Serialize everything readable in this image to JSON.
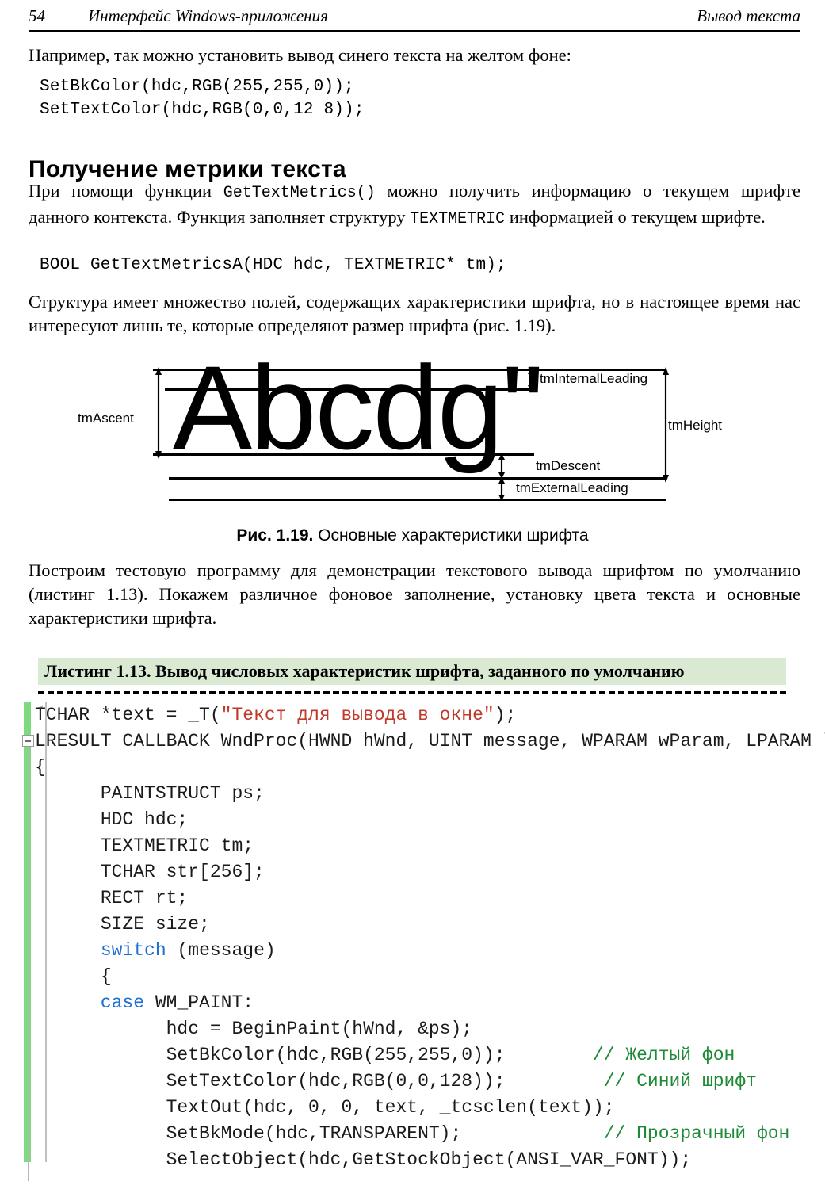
{
  "header": {
    "folio": "54",
    "left_title": "Интерфейс Windows-приложения",
    "right_title": "Вывод текста"
  },
  "intro": {
    "paragraph": "Например, так можно установить вывод синего текста на желтом фоне:",
    "code": [
      "SetBkColor(hdc,RGB(255,255,0));",
      "SetTextColor(hdc,RGB(0,0,12 8));"
    ]
  },
  "section": {
    "heading": "Получение метрики текста",
    "p1_a": "При помощи функции ",
    "p1_mono1": "GetTextMetrics()",
    "p1_b": " можно получить информацию о текущем шрифте данного контекста. Функция заполняет структуру ",
    "p1_mono2": "TEXTMETRIC",
    "p1_c": " информацией о текущем шрифте.",
    "signature": "BOOL GetTextMetricsA(HDC hdc, TEXTMETRIC* tm);",
    "p2": "Структура имеет множество полей, содержащих характеристики шрифта, но в настоящее время нас интересуют лишь те, которые определяют размер шрифта (рис. 1.19)."
  },
  "figure": {
    "sample_text": "Abcdg\"",
    "labels": {
      "ascent": "tmAscent",
      "internal_leading": "tmInternalLeading",
      "height": "tmHeight",
      "descent": "tmDescent",
      "external_leading": "tmExternalLeading"
    },
    "caption_bold": "Рис. 1.19.",
    "caption_rest": " Основные характеристики шрифта"
  },
  "after_figure": {
    "paragraph": "Построим тестовую программу для демонстрации текстового вывода шрифтом по умолчанию (листинг 1.13). Покажем различное фоновое заполнение, установку цвета текста и основные характеристики шрифта."
  },
  "listing": {
    "title": "Листинг 1.13. Вывод числовых характеристик шрифта, заданного по умолчанию",
    "header_bg": "#d9e9d2",
    "gutter_color": "#7fda7f",
    "string_color": "#c0392b",
    "keyword_color": "#1d6fd4",
    "comment_color": "#1e8a36",
    "code": [
      {
        "indent": 0,
        "parts": [
          {
            "t": "TCHAR *text = _T(",
            "c": "plain"
          },
          {
            "t": "\"Текст для вывода в окне\"",
            "c": "str"
          },
          {
            "t": ");",
            "c": "plain"
          }
        ]
      },
      {
        "indent": 0,
        "parts": [
          {
            "t": "LRESULT CALLBACK WndProc(HWND hWnd, UINT message, WPARAM wParam, LPARAM lParam)",
            "c": "plain"
          }
        ]
      },
      {
        "indent": 0,
        "parts": [
          {
            "t": "{",
            "c": "plain"
          }
        ]
      },
      {
        "indent": 0,
        "parts": [
          {
            "t": "      PAINTSTRUCT ps;",
            "c": "plain"
          }
        ]
      },
      {
        "indent": 0,
        "parts": [
          {
            "t": "      HDC hdc;",
            "c": "plain"
          }
        ]
      },
      {
        "indent": 0,
        "parts": [
          {
            "t": "      TEXTMETRIC tm;",
            "c": "plain"
          }
        ]
      },
      {
        "indent": 0,
        "parts": [
          {
            "t": "      TCHAR str[256];",
            "c": "plain"
          }
        ]
      },
      {
        "indent": 0,
        "parts": [
          {
            "t": "      RECT rt;",
            "c": "plain"
          }
        ]
      },
      {
        "indent": 0,
        "parts": [
          {
            "t": "      SIZE size;",
            "c": "plain"
          }
        ]
      },
      {
        "indent": 0,
        "parts": [
          {
            "t": "      ",
            "c": "plain"
          },
          {
            "t": "switch",
            "c": "kw"
          },
          {
            "t": " (message)",
            "c": "plain"
          }
        ]
      },
      {
        "indent": 0,
        "parts": [
          {
            "t": "      {",
            "c": "plain"
          }
        ]
      },
      {
        "indent": 0,
        "parts": [
          {
            "t": "      ",
            "c": "plain"
          },
          {
            "t": "case",
            "c": "kw"
          },
          {
            "t": " WM_PAINT:",
            "c": "plain"
          }
        ]
      },
      {
        "indent": 0,
        "parts": [
          {
            "t": "            hdc = BeginPaint(hWnd, &ps);",
            "c": "plain"
          }
        ]
      },
      {
        "indent": 0,
        "parts": [
          {
            "t": "            SetBkColor(hdc,RGB(255,255,0));        ",
            "c": "plain"
          },
          {
            "t": "// Желтый фон",
            "c": "cm"
          }
        ]
      },
      {
        "indent": 0,
        "parts": [
          {
            "t": "            SetTextColor(hdc,RGB(0,0,128));         ",
            "c": "plain"
          },
          {
            "t": "// Синий шрифт",
            "c": "cm"
          }
        ]
      },
      {
        "indent": 0,
        "parts": [
          {
            "t": "            TextOut(hdc, 0, 0, text, _tcsclen(text));",
            "c": "plain"
          }
        ]
      },
      {
        "indent": 0,
        "parts": [
          {
            "t": "            SetBkMode(hdc,TRANSPARENT);             ",
            "c": "plain"
          },
          {
            "t": "// Прозрачный фон",
            "c": "cm"
          }
        ]
      },
      {
        "indent": 0,
        "parts": [
          {
            "t": "            SelectObject(hdc,GetStockObject(ANSI_VAR_FONT));",
            "c": "plain"
          }
        ]
      }
    ]
  }
}
